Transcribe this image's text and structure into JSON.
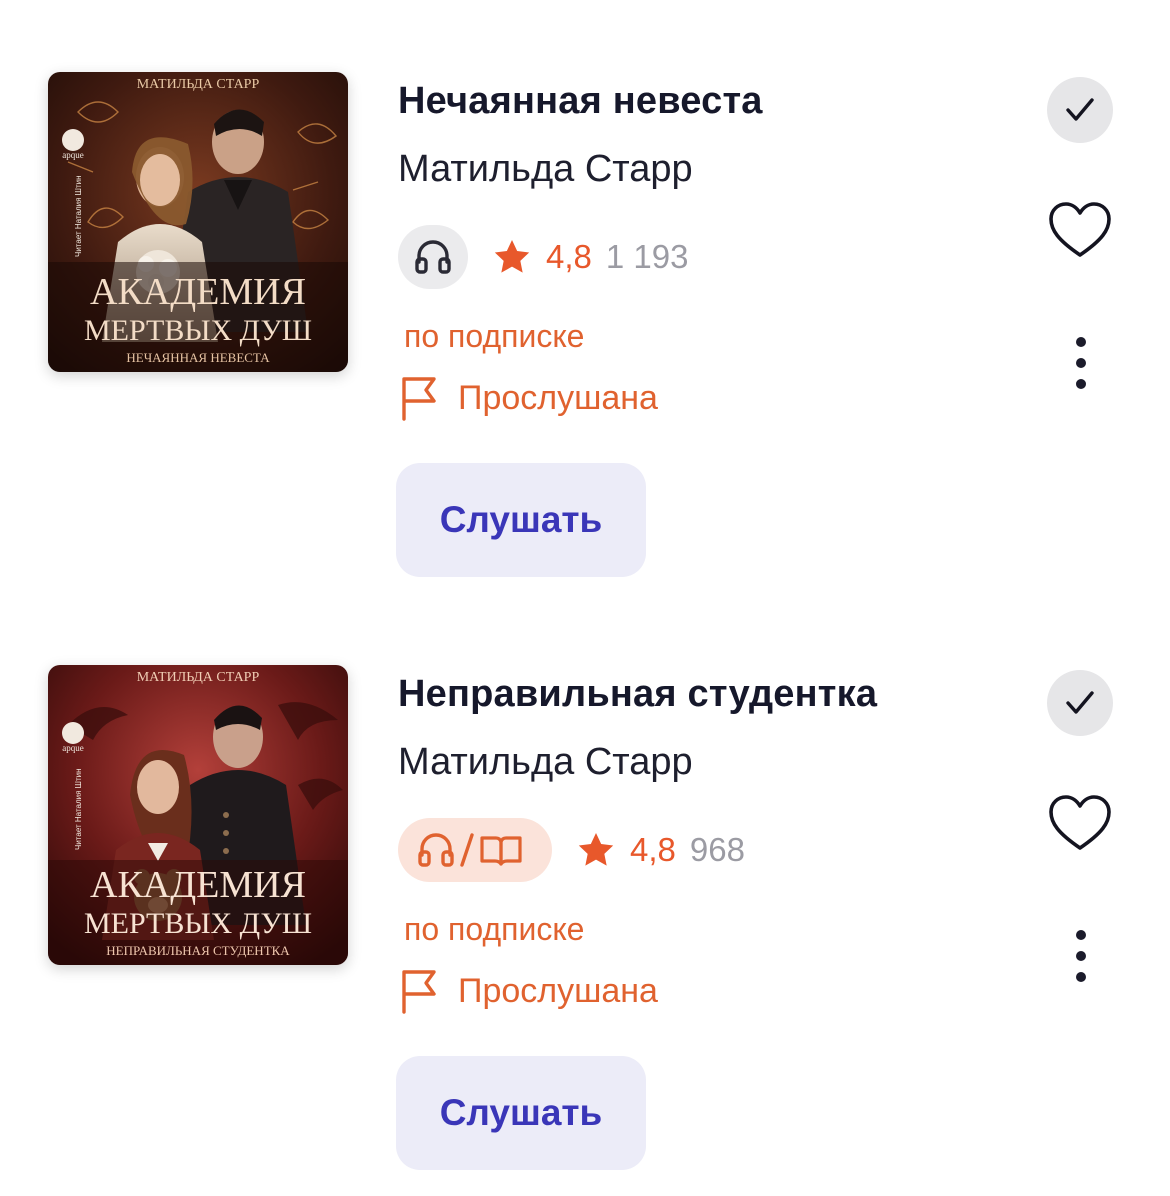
{
  "books": [
    {
      "title": "Нечаянная невеста",
      "author": "Матильда Старр",
      "format": "audio",
      "format_icon": "headphones-icon",
      "rating": "4,8",
      "ratings_count": "1 193",
      "subscription_label": "по подписке",
      "status_label": "Прослушана",
      "action_label": "Слушать",
      "cover": {
        "author_line": "МАТИЛЬДА СТАРР",
        "series_line1": "АКАДЕМИЯ",
        "series_line2": "МЕРТВЫХ ДУШ",
        "subtitle": "НЕЧАЯННАЯ НЕВЕСТА",
        "narrator": "Читает Наталия Штин",
        "publisher": "apque",
        "theme_color": "#6b2f1a"
      }
    },
    {
      "title": "Неправильная студентка",
      "author": "Матильда Старр",
      "format": "audio-and-text",
      "format_icon": "headphones-book-icon",
      "rating": "4,8",
      "ratings_count": "968",
      "subscription_label": "по подписке",
      "status_label": "Прослушана",
      "action_label": "Слушать",
      "cover": {
        "author_line": "МАТИЛЬДА СТАРР",
        "series_line1": "АКАДЕМИЯ",
        "series_line2": "МЕРТВЫХ ДУШ",
        "subtitle": "НЕПРАВИЛЬНАЯ СТУДЕНТКА",
        "narrator": "Читает Наталия Штин",
        "publisher": "apque",
        "theme_color": "#8a1f1c"
      }
    }
  ],
  "colors": {
    "accent_orange": "#e0622f",
    "button_bg": "#ececf8",
    "button_text": "#3a36b8",
    "check_bg": "#e6e6e8"
  }
}
